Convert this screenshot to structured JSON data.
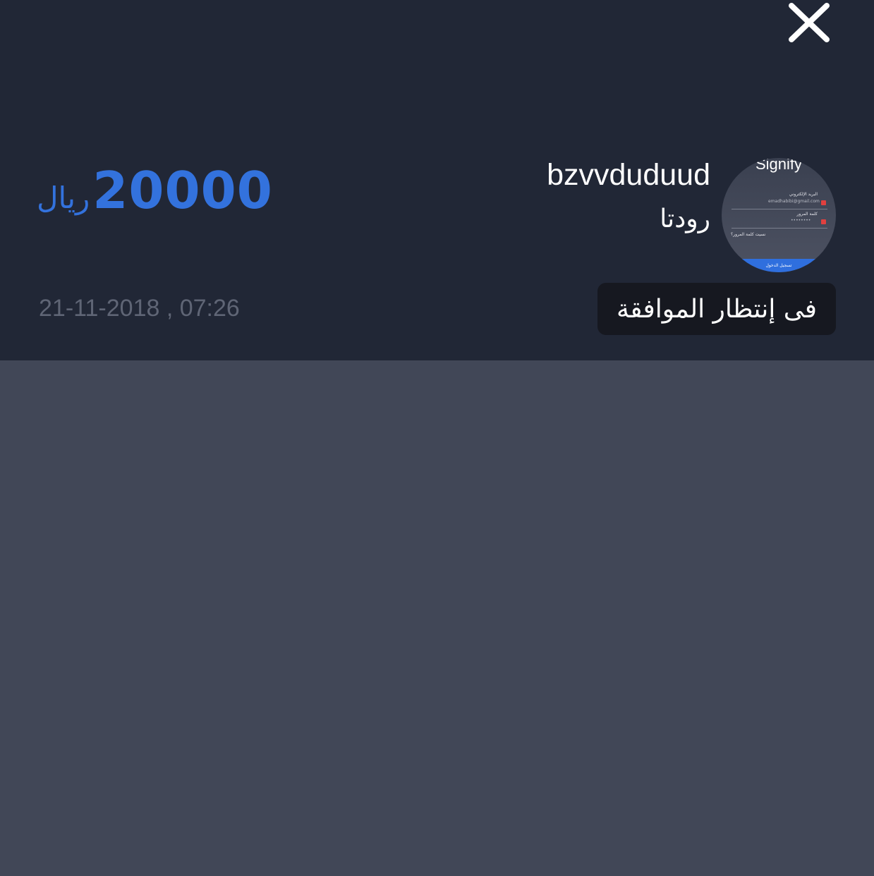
{
  "order": {
    "amount": "20000",
    "currency": "ريال",
    "timestamp": "21-11-2018 , 07:26",
    "user_name": "bzvvduduud",
    "item_title": "رودتا",
    "status": "فى إنتظار الموافقة"
  },
  "thumbnail": {
    "brand": "Signify",
    "email_label": "البريد الإلكتروني",
    "email_value": "emadhabibi@gmail.com",
    "password_label": "كلمة المرور",
    "password_value": "••••••••",
    "forgot_label": "نسيت كلمة المرور؟",
    "login_button": "تسجيل الدخول"
  },
  "icons": {
    "close": "close-icon"
  },
  "colors": {
    "header_bg": "#212736",
    "page_bg": "#414757",
    "accent": "#3372dd",
    "badge_bg": "#161820",
    "timestamp": "#5f6575"
  }
}
